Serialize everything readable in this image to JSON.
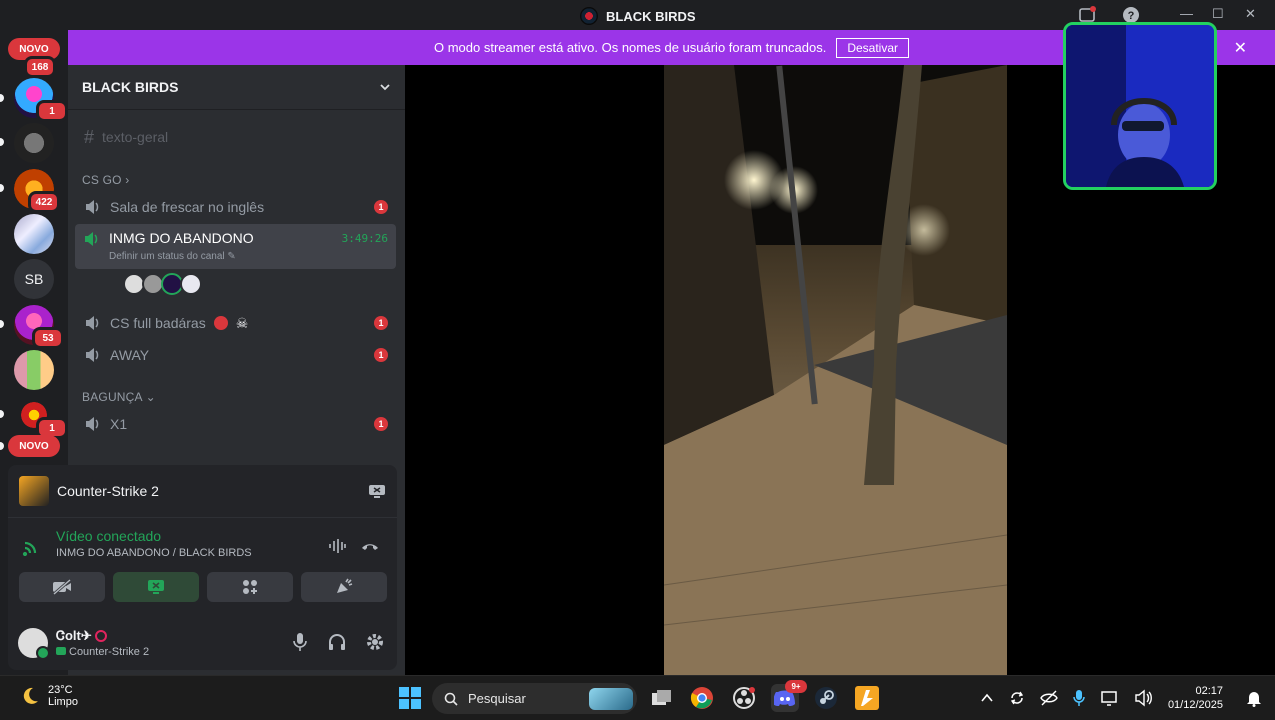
{
  "window": {
    "title": "BLACK BIRDS"
  },
  "banner": {
    "text": "O modo streamer está ativo. Os nomes de usuário foram truncados.",
    "button": "Desativar"
  },
  "guilds": {
    "new_top": "NOVO",
    "new_top_count": "168",
    "items": [
      {
        "badge": "1"
      },
      {
        "badge": ""
      },
      {
        "badge": "422"
      },
      {
        "badge": ""
      },
      {
        "label": "SB",
        "badge": ""
      },
      {
        "badge": "53"
      },
      {
        "badge": ""
      },
      {
        "badge": "1"
      }
    ],
    "new_bottom": "NOVO"
  },
  "server": {
    "name": "BLACK BIRDS"
  },
  "channels": {
    "text_general": "texto-geral",
    "cat_csgo": "CS GO",
    "c1": "Sala de frescar no inglês",
    "c1_badge": "1",
    "active_name": "INMG DO ABANDONO",
    "active_time": "3:49:26",
    "active_status": "Definir um status do canal",
    "c3": "CS full badáras",
    "c3_badge": "1",
    "c4": "AWAY",
    "c4_badge": "1",
    "cat_bagunca": "BAGUNÇA",
    "c5": "X1",
    "c5_badge": "1"
  },
  "panel": {
    "game": "Counter-Strike 2",
    "rtc_status": "Vídeo conectado",
    "rtc_location": "INMG DO ABANDONO / BLACK BIRDS",
    "user_name": "Ꮳolt✈",
    "user_activity": "Counter-Strike 2"
  },
  "taskbar": {
    "temp": "23°C",
    "condition": "Limpo",
    "search_placeholder": "Pesquisar",
    "discord_badge": "9+",
    "time": "02:17",
    "date": "01/12/2025"
  },
  "colors": {
    "accent": "#9b35e8",
    "online": "#23a559",
    "danger": "#da373c"
  }
}
